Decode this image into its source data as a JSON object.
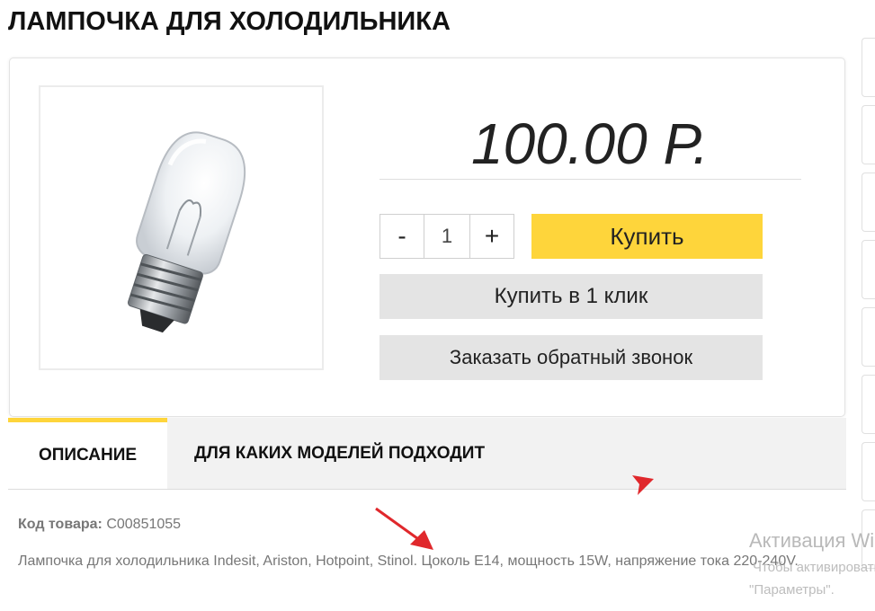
{
  "page": {
    "title": "ЛАМПОЧКА ДЛЯ ХОЛОДИЛЬНИКА"
  },
  "product": {
    "image_icon": "refrigerator-bulb-image",
    "price": "100.00 Р.",
    "quantity": {
      "minus_label": "-",
      "value": "1",
      "plus_label": "+"
    },
    "buy_label": "Купить",
    "one_click_label": "Купить в 1 клик",
    "callback_label": "Заказать обратный звонок"
  },
  "tabs": [
    {
      "label": "ОПИСАНИЕ",
      "active": true
    },
    {
      "label": "ДЛЯ КАКИХ МОДЕЛЕЙ ПОДХОДИТ",
      "active": false
    }
  ],
  "details": {
    "code_label": "Код товара:",
    "code_value": "C00851055",
    "description": "Лампочка для холодильника Indesit, Ariston, Hotpoint, Stinol. Цоколь E14, мощность 15W, напряжение тока 220-240V."
  },
  "watermark": {
    "title": "Активация Windows",
    "line1": "Чтобы активировать Windows, перейдите в раздел",
    "line2": "\"Параметры\"."
  },
  "colors": {
    "accent_yellow": "#fed53b",
    "button_gray": "#e4e4e4",
    "tab_bar": "#f2f2f2",
    "annotation_red": "#e0282c"
  }
}
